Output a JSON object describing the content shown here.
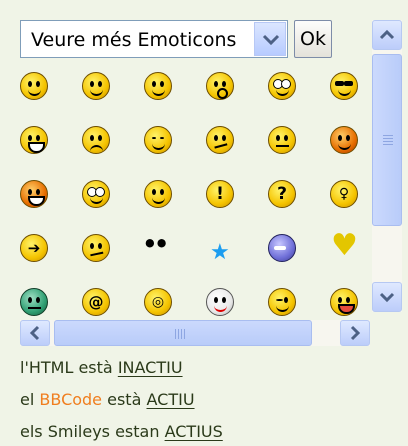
{
  "controls": {
    "select_value": "Veure més Emoticons",
    "ok_label": "Ok"
  },
  "emoticons": [
    [
      "grin",
      "smile",
      "laugh",
      "surprised",
      "rolleyes",
      "cool"
    ],
    [
      "biggrin",
      "angry",
      "happy",
      "confused",
      "neutral",
      "evil"
    ],
    [
      "mad",
      "rolleyes2",
      "smile2",
      "exclaim",
      "question",
      "idea"
    ],
    [
      "arrow",
      "sad",
      "geek",
      "star",
      "ninja",
      "heart"
    ],
    [
      "sick",
      "alien",
      "wink",
      "clown",
      "wink2",
      "tongue"
    ]
  ],
  "status": {
    "html_prefix": "l'HTML està",
    "html_state": "INACTIU",
    "bb_prefix": "el",
    "bb_name": "BBCode",
    "bb_suffix": "està",
    "bb_state": "ACTIU",
    "smileys_prefix": "els Smileys estan",
    "smileys_state": "ACTIUS"
  },
  "colors": {
    "background": "#f0f4e7",
    "bbcode": "#f07e1f",
    "scrollbar": "#bccdfa"
  }
}
